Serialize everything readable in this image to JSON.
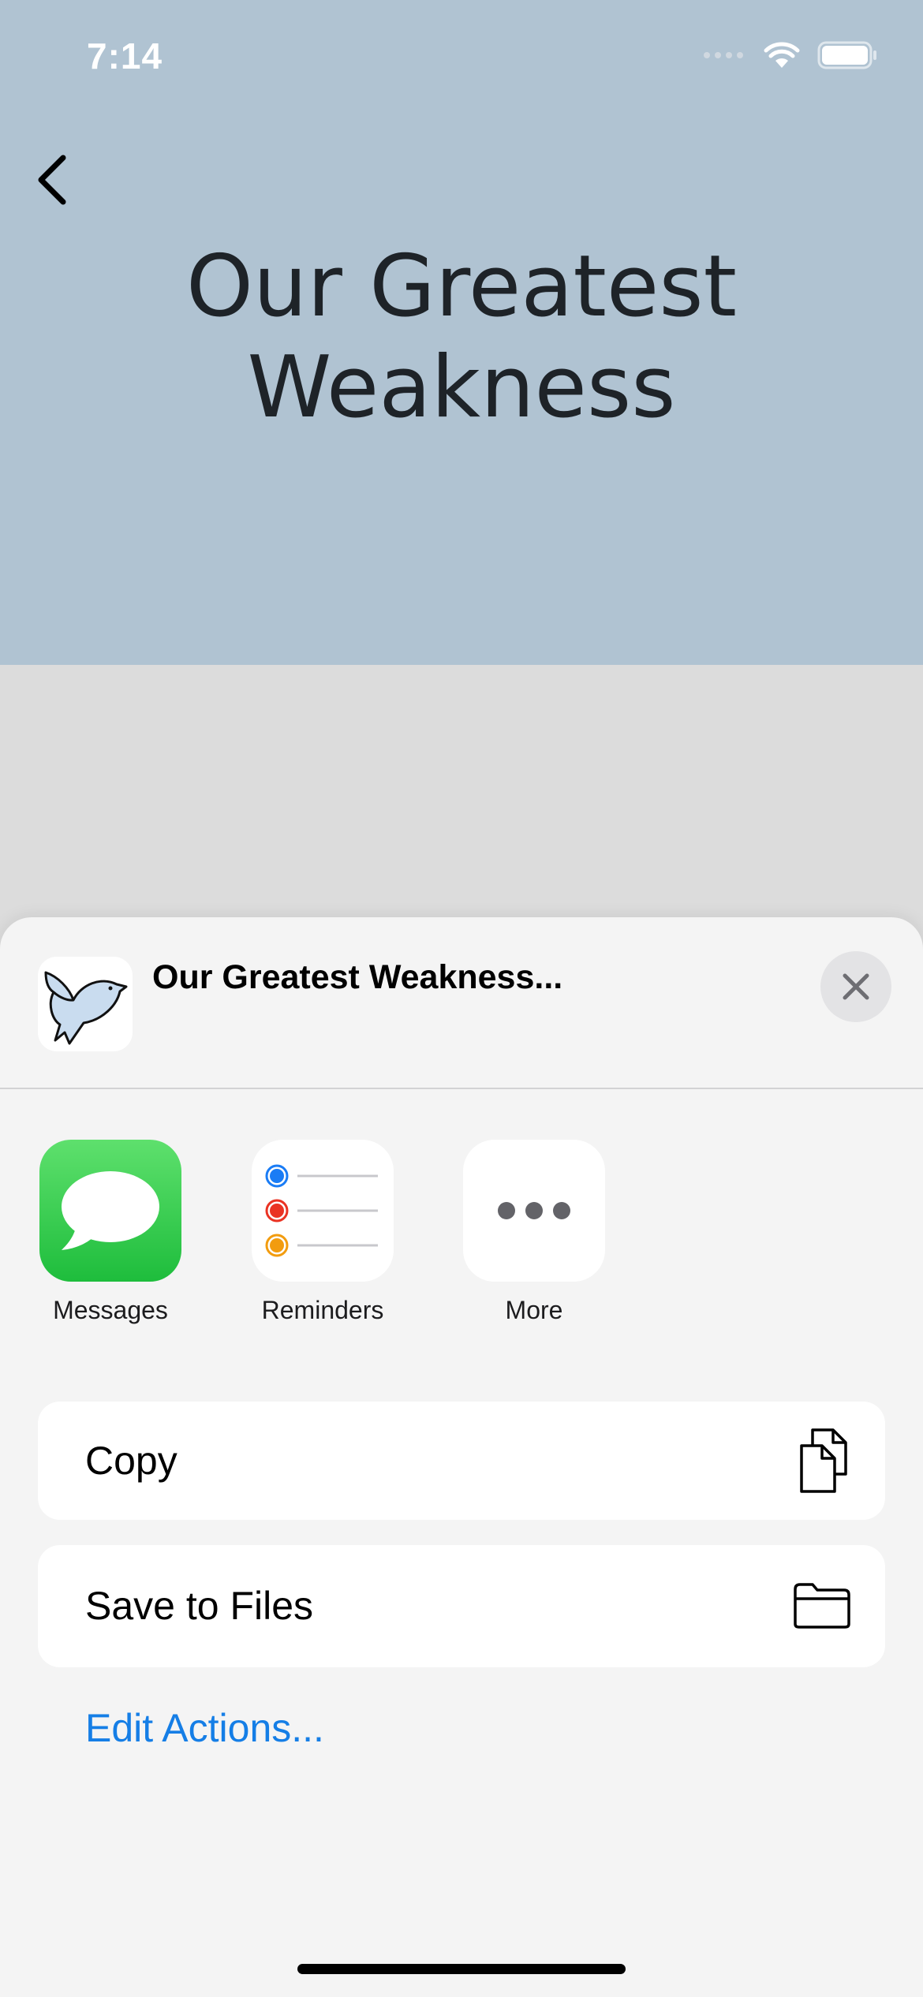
{
  "status_bar": {
    "time": "7:14"
  },
  "hero": {
    "title": "Our Greatest\nWeakness",
    "peek_text": "O"
  },
  "share_sheet": {
    "title": "Our Greatest Weakness...",
    "apps": [
      {
        "label": "Messages",
        "icon": "messages-icon",
        "color": "#34c759"
      },
      {
        "label": "Reminders",
        "icon": "reminders-icon",
        "colors": [
          "#1a7cf5",
          "#ea3323",
          "#f29c0f"
        ]
      },
      {
        "label": "More",
        "icon": "more-icon"
      }
    ],
    "actions": [
      {
        "label": "Copy",
        "icon": "copy-icon"
      },
      {
        "label": "Save to Files",
        "icon": "folder-icon"
      }
    ],
    "edit_actions_label": "Edit Actions...",
    "accent_color": "#157ee6"
  }
}
